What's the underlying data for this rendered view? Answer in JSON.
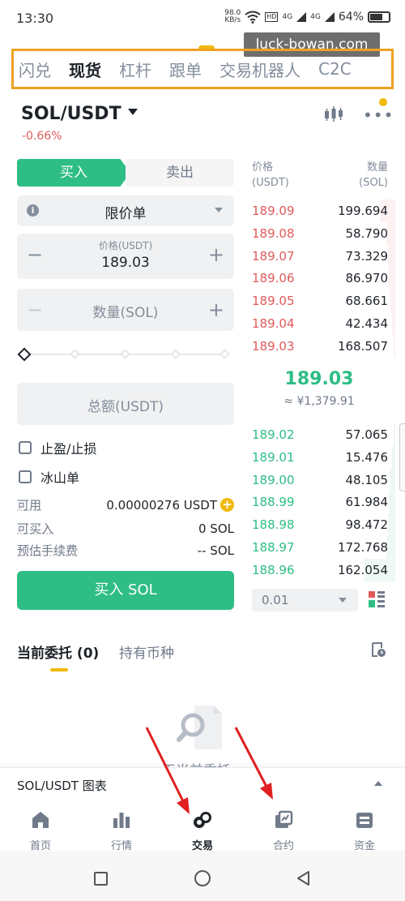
{
  "status_bar": {
    "time": "13:30",
    "net_speed": "98.0",
    "net_unit": "KB/s",
    "signal_1": "4G",
    "signal_2": "4G",
    "battery": "64%"
  },
  "watermark": "luck-bowan.com",
  "top_tabs": [
    {
      "label": "闪兑",
      "active": false
    },
    {
      "label": "现货",
      "active": true
    },
    {
      "label": "杠杆",
      "active": false
    },
    {
      "label": "跟单",
      "active": false
    },
    {
      "label": "交易机器人",
      "active": false
    },
    {
      "label": "C2C",
      "active": false
    }
  ],
  "pair": {
    "symbol": "SOL/USDT",
    "change": "-0.66%"
  },
  "order_form": {
    "buy_label": "买入",
    "sell_label": "卖出",
    "order_type": "限价单",
    "price_label": "价格(USDT)",
    "price_value": "189.03",
    "qty_placeholder": "数量(SOL)",
    "total_placeholder": "总额(USDT)",
    "tp_sl_label": "止盈/止损",
    "iceberg_label": "冰山单",
    "available_label": "可用",
    "available_value": "0.00000276 USDT",
    "can_buy_label": "可买入",
    "can_buy_value": "0 SOL",
    "fee_label": "预估手续费",
    "fee_value": "-- SOL",
    "submit_label": "买入 SOL"
  },
  "order_book": {
    "price_header": "价格",
    "price_unit": "(USDT)",
    "qty_header": "数量",
    "qty_unit": "(SOL)",
    "asks": [
      {
        "price": "189.09",
        "qty": "199.694",
        "depth": 0.1
      },
      {
        "price": "189.08",
        "qty": "58.790",
        "depth": 0.06
      },
      {
        "price": "189.07",
        "qty": "73.329",
        "depth": 0.05
      },
      {
        "price": "189.06",
        "qty": "86.970",
        "depth": 0.04
      },
      {
        "price": "189.05",
        "qty": "68.661",
        "depth": 0.03
      },
      {
        "price": "189.04",
        "qty": "42.434",
        "depth": 0.02
      },
      {
        "price": "189.03",
        "qty": "168.507",
        "depth": 0.01
      }
    ],
    "last_price": "189.03",
    "cny_price": "≈ ¥1,379.91",
    "bids": [
      {
        "price": "189.02",
        "qty": "57.065",
        "depth": 0.01
      },
      {
        "price": "189.01",
        "qty": "15.476",
        "depth": 0.02
      },
      {
        "price": "189.00",
        "qty": "48.105",
        "depth": 0.03
      },
      {
        "price": "188.99",
        "qty": "61.984",
        "depth": 0.04
      },
      {
        "price": "188.98",
        "qty": "98.472",
        "depth": 0.05
      },
      {
        "price": "188.97",
        "qty": "172.768",
        "depth": 0.06
      },
      {
        "price": "188.96",
        "qty": "162.054",
        "depth": 0.2
      }
    ],
    "depth_step": "0.01"
  },
  "orders": {
    "tab_open": "当前委托 (0)",
    "tab_holdings": "持有币种",
    "empty_text": "无当前委托"
  },
  "chart_bar": {
    "label": "SOL/USDT 图表"
  },
  "bottom_nav": [
    {
      "label": "首页",
      "icon": "home-icon",
      "active": false
    },
    {
      "label": "行情",
      "icon": "markets-icon",
      "active": false
    },
    {
      "label": "交易",
      "icon": "trade-icon",
      "active": true
    },
    {
      "label": "合约",
      "icon": "futures-icon",
      "active": false
    },
    {
      "label": "资金",
      "icon": "wallet-icon",
      "active": false
    }
  ],
  "colors": {
    "buy": "#2ebd85",
    "sell": "#e05a5a",
    "accent": "#f0b90b",
    "highlight_box": "#f0a020",
    "annotation_arrow": "#e02020"
  }
}
